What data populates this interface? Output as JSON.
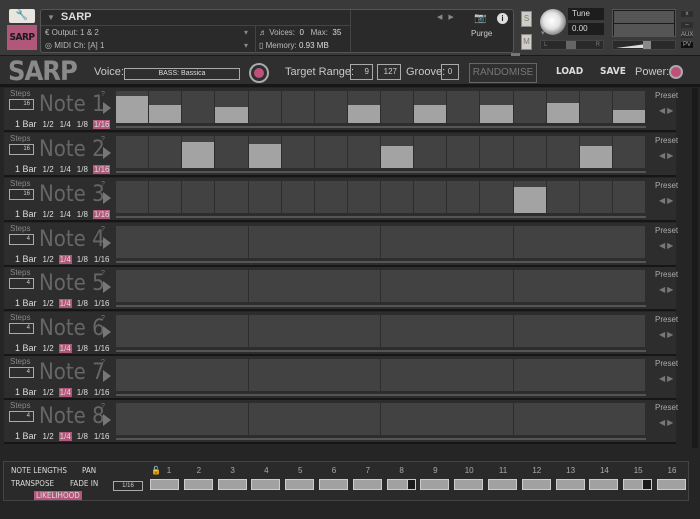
{
  "header": {
    "instrument_name": "SARP",
    "logo_text": "SARP",
    "output_label": "Output:",
    "output_value": "1 & 2",
    "midi_label": "MIDI Ch:",
    "midi_value": "[A] 1",
    "voices_label": "Voices:",
    "voices_value": "0",
    "max_label": "Max:",
    "max_value": "35",
    "memory_label": "Memory:",
    "memory_value": "0.93 MB",
    "purge_label": "Purge",
    "solo_label": "S",
    "mute_label": "M",
    "tune_label": "Tune",
    "tune_value": "0.00",
    "pan_left": "L",
    "pan_right": "R",
    "vol_minus": "-",
    "vol_plus": "+",
    "win_close": "x",
    "win_min": "–",
    "win_aux": "AUX",
    "win_pv": "PV"
  },
  "toolbar": {
    "title": "SARP",
    "voice_label": "Voice:",
    "voice_value": "BASS: Bassica",
    "target_range_label": "Target Range:",
    "range_low": "9",
    "range_high": "127",
    "groove_label": "Groove:",
    "groove_value": "0",
    "randomise_label": "RANDOMISE",
    "load_label": "LOAD",
    "save_label": "SAVE",
    "power_label": "Power:"
  },
  "accent_color": "#b0577a",
  "note_rows": [
    {
      "name": "Note 1",
      "steps": "16",
      "division": "1/16",
      "values": [
        0.85,
        0.55,
        0,
        0.5,
        0,
        0,
        0,
        0.55,
        0,
        0.55,
        0,
        0.55,
        0,
        0.63,
        0,
        0.42
      ]
    },
    {
      "name": "Note 2",
      "steps": "16",
      "division": "1/16",
      "values": [
        0,
        0,
        0.8,
        0,
        0.75,
        0,
        0,
        0,
        0.68,
        0,
        0,
        0,
        0,
        0,
        0.68,
        0
      ]
    },
    {
      "name": "Note 3",
      "steps": "16",
      "division": "1/16",
      "values": [
        0,
        0,
        0,
        0,
        0,
        0,
        0,
        0,
        0,
        0,
        0,
        0,
        0.8,
        0,
        0,
        0
      ]
    },
    {
      "name": "Note 4",
      "steps": "4",
      "division": "1/4",
      "values": [
        0,
        0,
        0,
        0
      ]
    },
    {
      "name": "Note 5",
      "steps": "4",
      "division": "1/4",
      "values": [
        0,
        0,
        0,
        0
      ]
    },
    {
      "name": "Note 6",
      "steps": "4",
      "division": "1/4",
      "values": [
        0,
        0,
        0,
        0
      ]
    },
    {
      "name": "Note 7",
      "steps": "4",
      "division": "1/4",
      "values": [
        0,
        0,
        0,
        0
      ]
    },
    {
      "name": "Note 8",
      "steps": "4",
      "division": "1/4",
      "values": [
        0,
        0,
        0,
        0
      ]
    }
  ],
  "row_labels": {
    "steps": "Steps",
    "help": "?",
    "preset": "Preset",
    "divisions": [
      "1 Bar",
      "1/2",
      "1/4",
      "1/8",
      "1/16"
    ]
  },
  "bottom": {
    "note_lengths": "NOTE LENGTHS",
    "pan": "PAN",
    "transpose": "TRANSPOSE",
    "fade_in": "FADE IN",
    "likelihood": "LIKELIHOOD",
    "length_value": "1/16",
    "step_numbers": [
      "1",
      "2",
      "3",
      "4",
      "5",
      "6",
      "7",
      "8",
      "9",
      "10",
      "11",
      "12",
      "13",
      "14",
      "15",
      "16"
    ],
    "step_fill": [
      1,
      1,
      1,
      1,
      1,
      1,
      1,
      0.7,
      1,
      1,
      1,
      1,
      1,
      1,
      0.65,
      1
    ]
  }
}
